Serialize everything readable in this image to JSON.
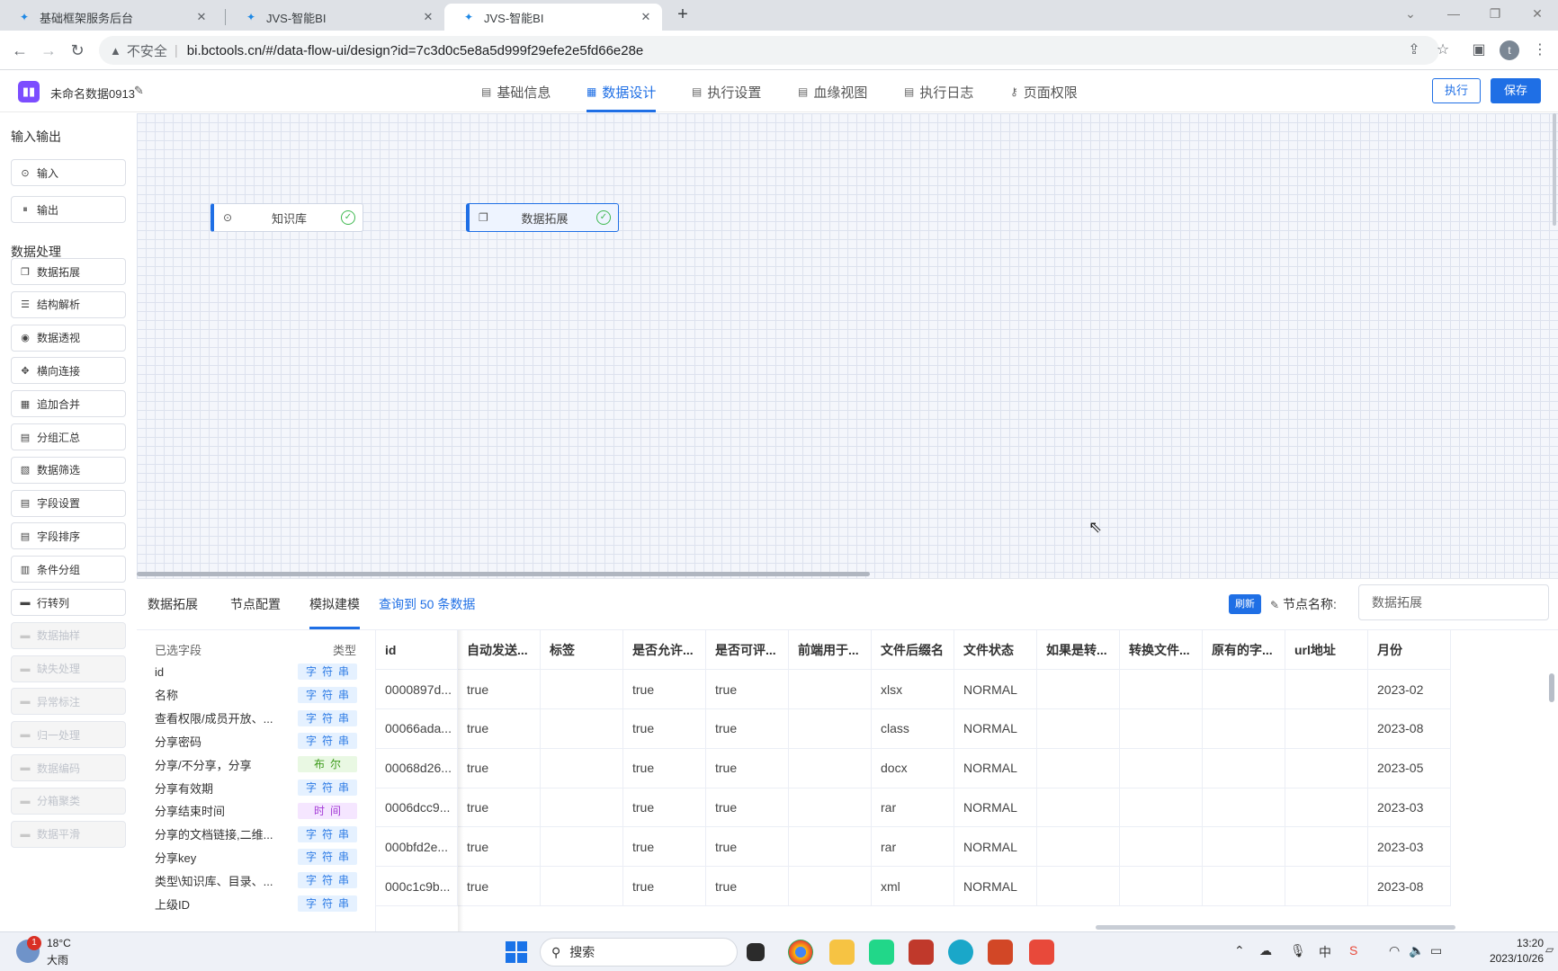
{
  "browser": {
    "tabs": [
      {
        "title": "基础框架服务后台",
        "active": false
      },
      {
        "title": "JVS-智能BI",
        "active": false
      },
      {
        "title": "JVS-智能BI",
        "active": true
      }
    ],
    "address": {
      "security_label": "不安全",
      "url": "bi.bctools.cn/#/data-flow-ui/design?id=7c3d0c5e8a5d999f29efe2e5fd66e28e"
    },
    "profile_initial": "t"
  },
  "app": {
    "title": "未命名数据0913",
    "nav_tabs": [
      {
        "label": "基础信息",
        "active": false
      },
      {
        "label": "数据设计",
        "active": true
      },
      {
        "label": "执行设置",
        "active": false
      },
      {
        "label": "血缘视图",
        "active": false
      },
      {
        "label": "执行日志",
        "active": false
      },
      {
        "label": "页面权限",
        "active": false
      }
    ],
    "run_label": "执行",
    "save_label": "保存"
  },
  "sidebar": {
    "io_heading": "输入输出",
    "io_items": [
      {
        "label": "输入",
        "icon": "play-circle-icon"
      },
      {
        "label": "输出",
        "icon": "pause-circle-icon"
      }
    ],
    "proc_heading": "数据处理",
    "proc_items": [
      {
        "label": "数据拓展",
        "icon": "copy-icon",
        "enabled": true
      },
      {
        "label": "结构解析",
        "icon": "sliders-icon",
        "enabled": true
      },
      {
        "label": "数据透视",
        "icon": "eye-icon",
        "enabled": true
      },
      {
        "label": "横向连接",
        "icon": "move-icon",
        "enabled": true
      },
      {
        "label": "追加合并",
        "icon": "calendar-icon",
        "enabled": true
      },
      {
        "label": "分组汇总",
        "icon": "document-icon",
        "enabled": true
      },
      {
        "label": "数据筛选",
        "icon": "filter-doc-icon",
        "enabled": true
      },
      {
        "label": "字段设置",
        "icon": "document-icon",
        "enabled": true
      },
      {
        "label": "字段排序",
        "icon": "document-icon",
        "enabled": true
      },
      {
        "label": "条件分组",
        "icon": "group-icon",
        "enabled": true
      },
      {
        "label": "行转列",
        "icon": "rows-icon",
        "enabled": true
      },
      {
        "label": "数据抽样",
        "icon": "rows-icon",
        "enabled": false
      },
      {
        "label": "缺失处理",
        "icon": "rows-icon",
        "enabled": false
      },
      {
        "label": "异常标注",
        "icon": "rows-icon",
        "enabled": false
      },
      {
        "label": "归一处理",
        "icon": "rows-icon",
        "enabled": false
      },
      {
        "label": "数据编码",
        "icon": "rows-icon",
        "enabled": false
      },
      {
        "label": "分箱聚类",
        "icon": "rows-icon",
        "enabled": false
      },
      {
        "label": "数据平滑",
        "icon": "rows-icon",
        "enabled": false
      }
    ]
  },
  "canvas": {
    "nodes": [
      {
        "label": "知识库",
        "icon": "play-circle-icon",
        "status": "success",
        "selected": false
      },
      {
        "label": "数据拓展",
        "icon": "copy-icon",
        "status": "success",
        "selected": true
      }
    ]
  },
  "panel": {
    "tabs": [
      {
        "label": "数据拓展",
        "active": false
      },
      {
        "label": "节点配置",
        "active": false
      },
      {
        "label": "模拟建模",
        "active": true
      }
    ],
    "query_info": "查询到 50 条数据",
    "refresh_label": "刷新",
    "node_name_label": "节点名称:",
    "node_name_value": "数据拓展",
    "fields_header": {
      "name": "已选字段",
      "type": "类型"
    },
    "fields": [
      {
        "name": "id",
        "type": "字符串",
        "kind": "string"
      },
      {
        "name": "名称",
        "type": "字符串",
        "kind": "string"
      },
      {
        "name": "查看权限/成员开放、...",
        "type": "字符串",
        "kind": "string"
      },
      {
        "name": "分享密码",
        "type": "字符串",
        "kind": "string"
      },
      {
        "name": "分享/不分享，分享",
        "type": "布尔",
        "kind": "bool"
      },
      {
        "name": "分享有效期",
        "type": "字符串",
        "kind": "string"
      },
      {
        "name": "分享结束时间",
        "type": "时间",
        "kind": "time"
      },
      {
        "name": "分享的文档链接,二维...",
        "type": "字符串",
        "kind": "string"
      },
      {
        "name": "分享key",
        "type": "字符串",
        "kind": "string"
      },
      {
        "name": "类型\\知识库、目录、...",
        "type": "字符串",
        "kind": "string"
      },
      {
        "name": "上级ID",
        "type": "字符串",
        "kind": "string"
      }
    ],
    "columns": [
      "id",
      "自动发送...",
      "标签",
      "是否允许...",
      "是否可评...",
      "前端用于...",
      "文件后缀名",
      "文件状态",
      "如果是转...",
      "转换文件...",
      "原有的字...",
      "url地址",
      "月份"
    ],
    "rows": [
      [
        "0000897d...",
        "true",
        "",
        "true",
        "true",
        "",
        "xlsx",
        "NORMAL",
        "",
        "",
        "",
        "",
        "2023-02"
      ],
      [
        "00066ada...",
        "true",
        "",
        "true",
        "true",
        "",
        "class",
        "NORMAL",
        "",
        "",
        "",
        "",
        "2023-08"
      ],
      [
        "00068d26...",
        "true",
        "",
        "true",
        "true",
        "",
        "docx",
        "NORMAL",
        "",
        "",
        "",
        "",
        "2023-05"
      ],
      [
        "0006dcc9...",
        "true",
        "",
        "true",
        "true",
        "",
        "rar",
        "NORMAL",
        "",
        "",
        "",
        "",
        "2023-03"
      ],
      [
        "000bfd2e...",
        "true",
        "",
        "true",
        "true",
        "",
        "rar",
        "NORMAL",
        "",
        "",
        "",
        "",
        "2023-03"
      ],
      [
        "000c1c9b...",
        "true",
        "",
        "true",
        "true",
        "",
        "xml",
        "NORMAL",
        "",
        "",
        "",
        "",
        "2023-08"
      ]
    ]
  },
  "taskbar": {
    "weather_badge": "1",
    "temperature": "18°C",
    "weather": "大雨",
    "search_label": "搜索",
    "time": "13:20",
    "date": "2023/10/26",
    "ime": "中"
  }
}
